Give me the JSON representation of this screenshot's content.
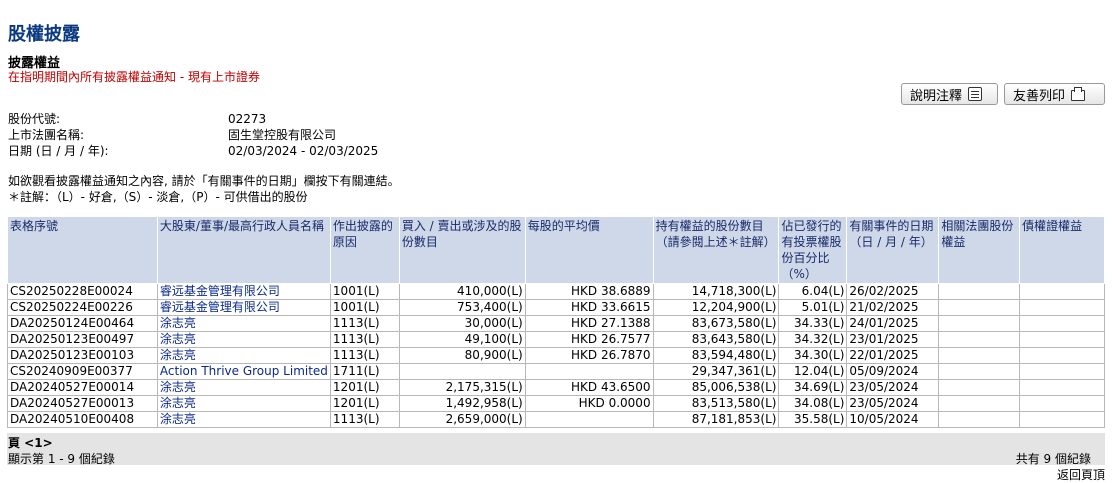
{
  "page": {
    "title": "股權披露",
    "subtitle": "披露權益",
    "subtitle2": "在指明期間內所有披露權益通知 - 現有上市證券"
  },
  "buttons": {
    "notes": "說明注釋",
    "print": "友善列印"
  },
  "info": {
    "stock_code_label": "股份代號:",
    "stock_code": "02273",
    "company_label": "上市法團名稱:",
    "company": "固生堂控股有限公司",
    "date_label": "日期 (日 / 月 / 年):",
    "date": "02/03/2024 - 02/03/2025"
  },
  "notes": {
    "line1": "如欲觀看披露權益通知之內容, 請於「有關事件的日期」欄按下有關連結。",
    "line2": "＊註解：（L）- 好倉,（S）- 淡倉,（P）- 可供借出的股份"
  },
  "table": {
    "headers": [
      "表格序號",
      "大股東/董事/最高行政人員名稱",
      "作出披露的原因",
      "買入 / 賣出或涉及的股份數目",
      "每股的平均價",
      "持有權益的股份數目（請參閱上述＊註解）",
      "佔已發行的有投票權股份百分比（%）",
      "有關事件的日期（日 / 月 / 年）",
      "相關法團股份權益",
      "債權證權益"
    ],
    "rows": [
      [
        "CS20250228E00024",
        "睿远基金管理有限公司",
        "1001(L)",
        "410,000(L)",
        "HKD 38.6889",
        "14,718,300(L)",
        "6.04(L)",
        "26/02/2025",
        "",
        ""
      ],
      [
        "CS20250224E00226",
        "睿远基金管理有限公司",
        "1001(L)",
        "753,400(L)",
        "HKD 33.6615",
        "12,204,900(L)",
        "5.01(L)",
        "21/02/2025",
        "",
        ""
      ],
      [
        "DA20250124E00464",
        "涂志亮",
        "1113(L)",
        "30,000(L)",
        "HKD 27.1388",
        "83,673,580(L)",
        "34.33(L)",
        "24/01/2025",
        "",
        ""
      ],
      [
        "DA20250123E00497",
        "涂志亮",
        "1113(L)",
        "49,100(L)",
        "HKD 26.7577",
        "83,643,580(L)",
        "34.32(L)",
        "23/01/2025",
        "",
        ""
      ],
      [
        "DA20250123E00103",
        "涂志亮",
        "1113(L)",
        "80,900(L)",
        "HKD 26.7870",
        "83,594,480(L)",
        "34.30(L)",
        "22/01/2025",
        "",
        ""
      ],
      [
        "CS20240909E00377",
        "Action Thrive Group Limited",
        "1711(L)",
        "",
        "",
        "29,347,361(L)",
        "12.04(L)",
        "05/09/2024",
        "",
        ""
      ],
      [
        "DA20240527E00014",
        "涂志亮",
        "1201(L)",
        "2,175,315(L)",
        "HKD 43.6500",
        "85,006,538(L)",
        "34.69(L)",
        "23/05/2024",
        "",
        ""
      ],
      [
        "DA20240527E00013",
        "涂志亮",
        "1201(L)",
        "1,492,958(L)",
        "HKD 0.0000",
        "83,513,580(L)",
        "34.08(L)",
        "23/05/2024",
        "",
        ""
      ],
      [
        "DA20240510E00408",
        "涂志亮",
        "1113(L)",
        "2,659,000(L)",
        "",
        "87,181,853(L)",
        "35.58(L)",
        "10/05/2024",
        "",
        ""
      ]
    ]
  },
  "pager": {
    "page": "頁 <1>",
    "showing": "顯示第 1 - 9 個紀錄",
    "total": "共有 9 個紀錄"
  },
  "back_to_top": "返回頁頂"
}
